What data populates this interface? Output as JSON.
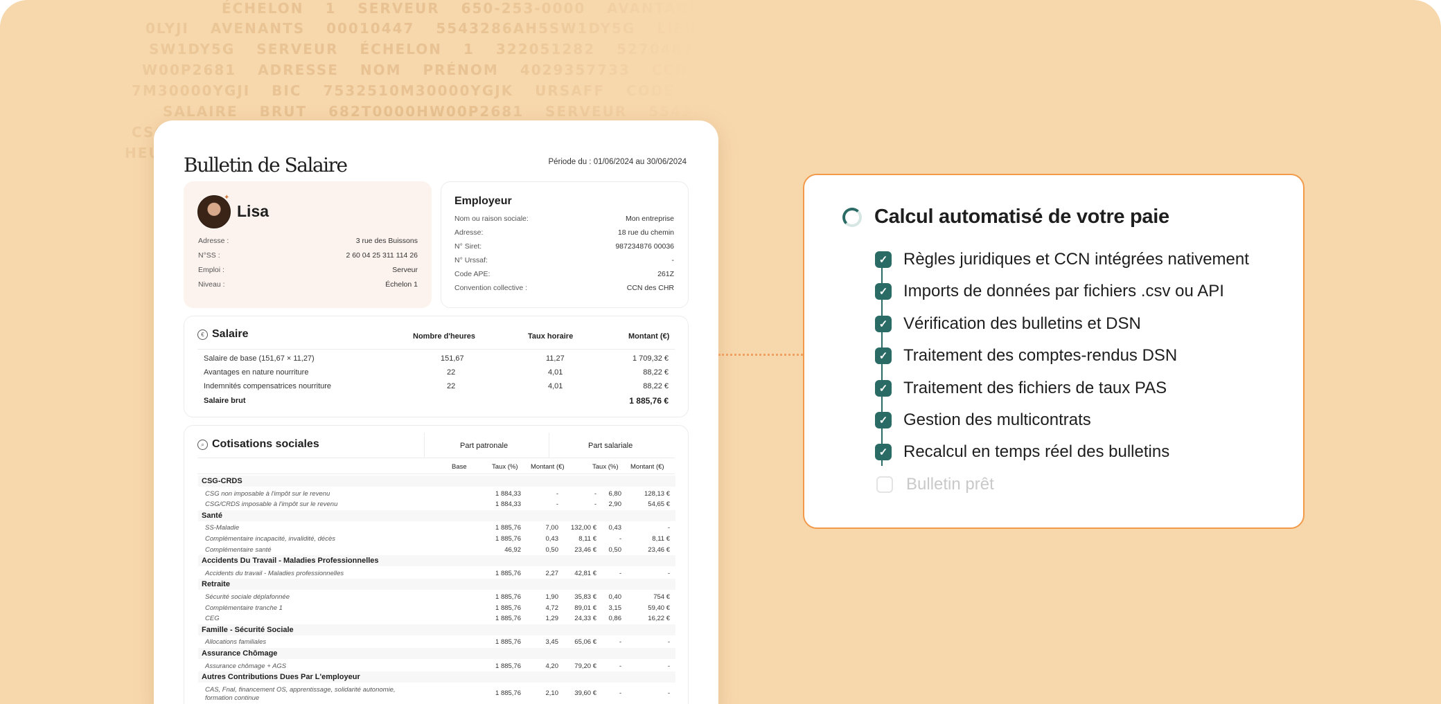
{
  "background_words": [
    "ÉCHELON 1  SERVEUR  650-253-0000  AVANTAGE - NATUR",
    "0LYJI  AVENANTS  00010447  5543286AH5SW1DY5G  LIEU  CCN",
    "SW1DY5G  SERVEUR  ÉCHELON  1  322051282  52704878DRLAHY754",
    "W00P2681  ADRESSE  NOM  PRÉNOM  4029357733  CCN  MON ENTREP",
    "7M30000YGJI  BIC  7532510M30000YGJK  URSAFF  CODE APE  17171  123",
    "SALAIRE BRUT  682T0000HW00P2681  SERVEUR  5543286JX5SPZMLZY",
    "CSG  VOTRE  AVANTAGE  ALSACE  MOSELLE  BRUT  PRÉCOMPTE  PRIME  CC",
    "HEURES  SUPPLÉMENTAIRES  NET  FISCAL  IMPOSABLE  2024  DSN  AVE"
  ],
  "payslip": {
    "title": "Bulletin de Salaire",
    "period": "Période du : 01/06/2024 au 30/06/2024",
    "employee": {
      "name": "Lisa",
      "fields": [
        {
          "label": "Adresse :",
          "value": "3 rue des Buissons"
        },
        {
          "label": "N°SS :",
          "value": "2 60 04 25 311 114 26"
        },
        {
          "label": "Emploi :",
          "value": "Serveur"
        },
        {
          "label": "Niveau :",
          "value": "Échelon 1"
        }
      ]
    },
    "employer": {
      "title": "Employeur",
      "fields": [
        {
          "label": "Nom ou raison sociale:",
          "value": "Mon entreprise"
        },
        {
          "label": "Adresse:",
          "value": "18 rue du chemin"
        },
        {
          "label": "N° Siret:",
          "value": "987234876 00036"
        },
        {
          "label": "N° Urssaf:",
          "value": "-"
        },
        {
          "label": "Code APE:",
          "value": "261Z"
        },
        {
          "label": "Convention collective :",
          "value": "CCN des CHR"
        }
      ]
    },
    "salaire": {
      "title": "Salaire",
      "icon": "euro-icon",
      "headers": [
        "Nombre d'heures",
        "Taux horaire",
        "Montant (€)"
      ],
      "rows": [
        {
          "label": "Salaire de base (151,67 × 11,27)",
          "hours": "151,67",
          "rate": "11,27",
          "amount": "1 709,32 €"
        },
        {
          "label": "Avantages en nature nourriture",
          "hours": "22",
          "rate": "4,01",
          "amount": "88,22 €"
        },
        {
          "label": "Indemnités compensatrices nourriture",
          "hours": "22",
          "rate": "4,01",
          "amount": "88,22 €"
        }
      ],
      "total_label": "Salaire brut",
      "total_amount": "1 885,76 €"
    },
    "cotisations": {
      "title": "Cotisations sociales",
      "icon": "search-icon",
      "part_patronale": "Part patronale",
      "part_salariale": "Part salariale",
      "headers": [
        "Base",
        "Taux (%)",
        "Montant (€)",
        "Taux (%)",
        "Montant (€)"
      ],
      "groups": [
        {
          "name": "CSG-CRDS",
          "rows": [
            {
              "label": "CSG non imposable à l'impôt sur le revenu",
              "base": "1 884,33",
              "pt": "-",
              "pm": "-",
              "st": "6,80",
              "sm": "128,13 €"
            },
            {
              "label": "CSG/CRDS imposable à l'impôt sur le revenu",
              "base": "1 884,33",
              "pt": "-",
              "pm": "-",
              "st": "2,90",
              "sm": "54,65 €"
            }
          ]
        },
        {
          "name": "Santé",
          "rows": [
            {
              "label": "SS-Maladie",
              "base": "1 885,76",
              "pt": "7,00",
              "pm": "132,00 €",
              "st": "0,43",
              "sm": "-"
            },
            {
              "label": "Complémentaire incapacité, invalidité, décès",
              "base": "1 885,76",
              "pt": "0,43",
              "pm": "8,11 €",
              "st": "-",
              "sm": "8,11 €"
            },
            {
              "label": "Complémentaire santé",
              "base": "46,92",
              "pt": "0,50",
              "pm": "23,46 €",
              "st": "0,50",
              "sm": "23,46 €"
            }
          ]
        },
        {
          "name": "Accidents Du Travail - Maladies Professionnelles",
          "rows": [
            {
              "label": "Accidents du travail - Maladies professionnelles",
              "base": "1 885,76",
              "pt": "2,27",
              "pm": "42,81 €",
              "st": "-",
              "sm": "-"
            }
          ]
        },
        {
          "name": "Retraite",
          "rows": [
            {
              "label": "Sécurité sociale déplafonnée",
              "base": "1 885,76",
              "pt": "1,90",
              "pm": "35,83 €",
              "st": "0,40",
              "sm": "754 €"
            },
            {
              "label": "Complémentaire tranche 1",
              "base": "1 885,76",
              "pt": "4,72",
              "pm": "89,01 €",
              "st": "3,15",
              "sm": "59,40 €"
            },
            {
              "label": "CEG",
              "base": "1 885,76",
              "pt": "1,29",
              "pm": "24,33 €",
              "st": "0,86",
              "sm": "16,22 €"
            }
          ]
        },
        {
          "name": "Famille - Sécurité Sociale",
          "rows": [
            {
              "label": "Allocations familiales",
              "base": "1 885,76",
              "pt": "3,45",
              "pm": "65,06 €",
              "st": "-",
              "sm": "-"
            }
          ]
        },
        {
          "name": "Assurance Chômage",
          "rows": [
            {
              "label": "Assurance chômage + AGS",
              "base": "1 885,76",
              "pt": "4,20",
              "pm": "79,20 €",
              "st": "-",
              "sm": "-"
            }
          ]
        },
        {
          "name": "Autres Contributions Dues Par L'employeur",
          "rows": [
            {
              "label": "CAS, Fnal, financement OS, apprentissage, solidarité autonomie, formation continue",
              "base": "1 885,76",
              "pt": "2,10",
              "pm": "39,60 €",
              "st": "-",
              "sm": "-"
            }
          ]
        }
      ]
    }
  },
  "feature_card": {
    "title": "Calcul automatisé de votre paie",
    "accent_color": "#2b6b66",
    "border_color": "#f29a4a",
    "items": [
      {
        "label": "Règles juridiques et CCN intégrées nativement",
        "done": true
      },
      {
        "label": "Imports de données par fichiers .csv ou API",
        "done": true
      },
      {
        "label": "Vérification des bulletins et DSN",
        "done": true
      },
      {
        "label": "Traitement des comptes-rendus DSN",
        "done": true
      },
      {
        "label": "Traitement des fichiers de taux PAS",
        "done": true
      },
      {
        "label": "Gestion des multicontrats",
        "done": true
      },
      {
        "label": "Recalcul en temps réel des bulletins",
        "done": true
      },
      {
        "label": "Bulletin prêt",
        "done": false
      }
    ]
  }
}
